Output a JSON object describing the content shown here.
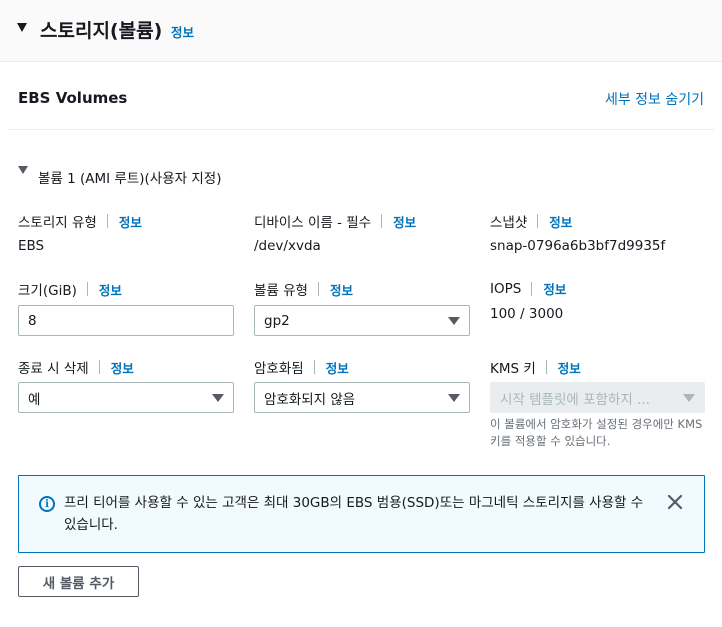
{
  "section": {
    "title": "스토리지(볼륨)",
    "info": "정보"
  },
  "ebs": {
    "title": "EBS Volumes",
    "hide_details": "세부 정보 숨기기"
  },
  "volume": {
    "title": "볼륨 1 (AMI 루트)(사용자 지정)",
    "storage_type": {
      "label": "스토리지 유형",
      "info": "정보",
      "value": "EBS"
    },
    "device_name": {
      "label": "디바이스 이름 - 필수",
      "info": "정보",
      "value": "/dev/xvda"
    },
    "snapshot": {
      "label": "스냅샷",
      "info": "정보",
      "value": "snap-0796a6b3bf7d9935f"
    },
    "size": {
      "label": "크기(GiB)",
      "info": "정보",
      "value": "8"
    },
    "volume_type": {
      "label": "볼륨 유형",
      "info": "정보",
      "value": "gp2"
    },
    "iops": {
      "label": "IOPS",
      "info": "정보",
      "value": "100 / 3000"
    },
    "delete_on_termination": {
      "label": "종료 시 삭제",
      "info": "정보",
      "value": "예"
    },
    "encrypted": {
      "label": "암호화됨",
      "info": "정보",
      "value": "암호화되지 않음"
    },
    "kms_key": {
      "label": "KMS 키",
      "info": "정보",
      "placeholder": "시작 템플릿에 포함하지 ...",
      "help": "이 볼륨에서 암호화가 설정된 경우에만 KMS 키를 적용할 수 있습니다."
    }
  },
  "alert": {
    "text": "프리 티어를 사용할 수 있는 고객은 최대 30GB의 EBS 범용(SSD)또는 마그네틱 스토리지를 사용할 수 있습니다."
  },
  "add_volume_button": "새 볼륨 추가",
  "colors": {
    "link": "#0073bb",
    "text": "#16191f",
    "border": "#aab7b8",
    "alert_bg": "#f1faff"
  }
}
